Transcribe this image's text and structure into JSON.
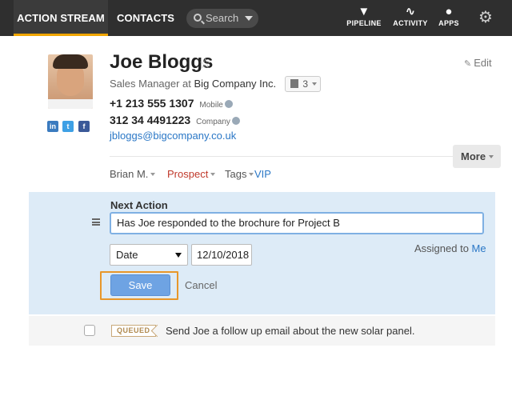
{
  "nav": {
    "action_stream": "ACTION STREAM",
    "contacts": "CONTACTS",
    "search_placeholder": "Search",
    "pipeline": "PIPELINE",
    "activity": "ACTIVITY",
    "apps": "APPS",
    "accent_color": "#f0a500"
  },
  "contact": {
    "name": "Joe Bloggs",
    "edit_label": "Edit",
    "title_prefix": "Sales Manager at ",
    "company": "Big Company Inc.",
    "company_count": "3",
    "phones": [
      {
        "number": "+1 213 555 1307",
        "type": "Mobile"
      },
      {
        "number": "312 34 4491223",
        "type": "Company"
      }
    ],
    "email": "jbloggs@bigcompany.co.uk",
    "social": {
      "linkedin": "in",
      "twitter": "t",
      "facebook": "f"
    },
    "more_label": "More",
    "owner": "Brian M.",
    "stage": "Prospect",
    "tags_label": "Tags",
    "tag": "VIP"
  },
  "next_action": {
    "title": "Next Action",
    "text": "Has Joe responded to the brochure for Project B",
    "date_type": "Date",
    "date_value": "12/10/2018",
    "assigned_prefix": "Assigned to ",
    "assigned_to": "Me",
    "save_label": "Save",
    "cancel_label": "Cancel"
  },
  "queued": {
    "badge": "QUEUED",
    "text": "Send Joe a follow up email about the new solar panel."
  }
}
